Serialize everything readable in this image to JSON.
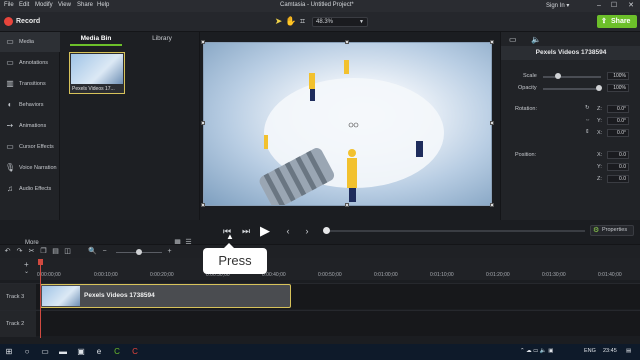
{
  "menubar": {
    "menus": [
      "File",
      "Edit",
      "Modify",
      "View",
      "Share",
      "Help"
    ],
    "title": "Camtasia - Untitled Project*",
    "signin": "Sign In ▾"
  },
  "toolbar": {
    "record_label": "Record",
    "zoom_value": "48.3%",
    "share_label": "Share"
  },
  "sidebar": {
    "items": [
      {
        "label": "Media",
        "icon": "media-icon"
      },
      {
        "label": "Annotations",
        "icon": "annotation-icon"
      },
      {
        "label": "Transitions",
        "icon": "transition-icon"
      },
      {
        "label": "Behaviors",
        "icon": "behavior-icon"
      },
      {
        "label": "Animations",
        "icon": "animation-icon"
      },
      {
        "label": "Cursor Effects",
        "icon": "cursor-icon"
      },
      {
        "label": "Voice Narration",
        "icon": "mic-icon"
      },
      {
        "label": "Audio Effects",
        "icon": "audio-icon"
      }
    ],
    "more_label": "More"
  },
  "media_bin": {
    "tabs": [
      "Media Bin",
      "Library"
    ],
    "thumb_caption": "Pexels Videos 17..."
  },
  "properties": {
    "clip_name": "Pexels Videos 1738594",
    "scale_label": "Scale",
    "scale_value": "100%",
    "scale_fraction": 0.25,
    "opacity_label": "Opacity",
    "opacity_value": "100%",
    "rotation_label": "Rotation:",
    "rotation": {
      "z": "0.0°",
      "y": "0.0°",
      "x": "0.0°"
    },
    "position_label": "Position:",
    "position": {
      "x": "0.0",
      "y": "0.0",
      "z": "0.0"
    },
    "axis_z": "Z:",
    "axis_y": "Y:",
    "axis_x": "X:",
    "button_label": "Properties"
  },
  "timeline": {
    "ticks": [
      "0:00:00;00",
      "0:00:10;00",
      "0:00:20;00",
      "0:00:30;00",
      "0:00:40;00",
      "0:00:50;00",
      "0:01:00;00",
      "0:01:10;00",
      "0:01:20;00",
      "0:01:30;00",
      "0:01:40;00"
    ],
    "tracks": [
      "Track 3",
      "Track 2"
    ],
    "clip_label": "Pexels Videos 1738594"
  },
  "tooltip": {
    "text": "Press"
  },
  "taskbar": {
    "lang": "ENG",
    "time": "23:45"
  },
  "colors": {
    "accent": "#6cbf2a",
    "record": "#e8453c",
    "clip_border": "#d7c25a",
    "playhead": "#d04a40"
  }
}
